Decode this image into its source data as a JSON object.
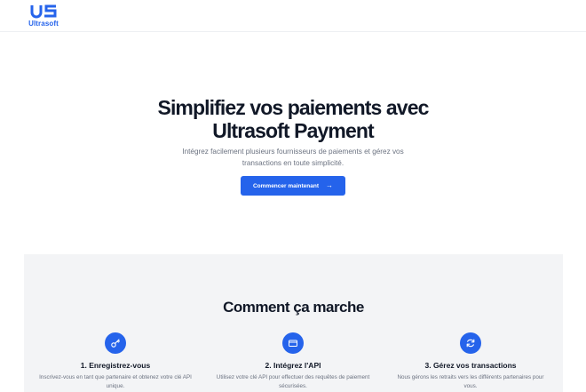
{
  "header": {
    "logo_mark": "US",
    "logo_text": "Ultrasoft"
  },
  "hero": {
    "title_line1": "Simplifiez vos paiements avec",
    "title_line2": "Ultrasoft Payment",
    "subtitle": "Intégrez facilement plusieurs fournisseurs de paiements et gérez vos transactions en toute simplicité.",
    "cta_label": "Commencer maintenant",
    "cta_icon": "arrow-right-icon"
  },
  "how": {
    "title": "Comment ça marche",
    "steps": [
      {
        "icon": "key-icon",
        "title": "1. Enregistrez-vous",
        "description": "Inscrivez-vous en tant que partenaire et obtenez votre clé API unique."
      },
      {
        "icon": "credit-card-icon",
        "title": "2. Intégrez l'API",
        "description": "Utilisez votre clé API pour effectuer des requêtes de paiement sécurisées."
      },
      {
        "icon": "refresh-icon",
        "title": "3. Gérez vos transactions",
        "description": "Nous gérons les retraits vers les différents partenaires pour vous."
      }
    ]
  },
  "colors": {
    "brand": "#2563eb",
    "section_bg": "#f3f4f6",
    "text": "#111827",
    "muted": "#6b7280"
  }
}
